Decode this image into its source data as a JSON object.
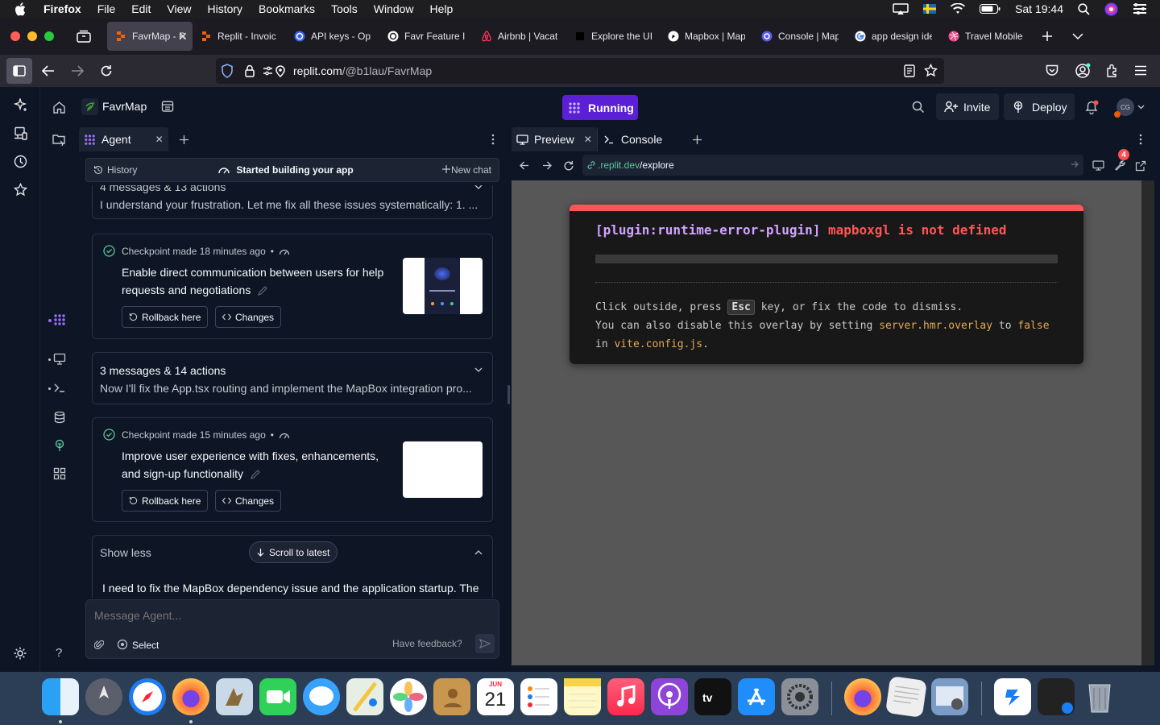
{
  "menubar": {
    "app": "Firefox",
    "items": [
      "File",
      "Edit",
      "View",
      "History",
      "Bookmarks",
      "Tools",
      "Window",
      "Help"
    ],
    "clock": "Sat 19:44"
  },
  "tabs": [
    {
      "label": "FavrMap - R",
      "active": true,
      "icon": "replit-icon"
    },
    {
      "label": "Replit - Invoic",
      "icon": "replit-icon"
    },
    {
      "label": "API keys - Op",
      "icon": "openai-icon"
    },
    {
      "label": "Favr Feature Ir",
      "icon": "chatgpt-icon"
    },
    {
      "label": "Airbnb | Vacat",
      "icon": "airbnb-icon"
    },
    {
      "label": "Explore the UI",
      "icon": "dribbble-icon"
    },
    {
      "label": "Mapbox | Map",
      "icon": "mapbox-icon"
    },
    {
      "label": "Console | Map",
      "icon": "console-icon"
    },
    {
      "label": "app design ide",
      "icon": "google-icon"
    },
    {
      "label": "Travel Mobile",
      "icon": "dribbble-icon"
    }
  ],
  "url": {
    "host": "replit.com",
    "path": "/@b1lau/FavrMap"
  },
  "replit": {
    "project": "FavrMap",
    "status": "Running",
    "invite": "Invite",
    "deploy": "Deploy",
    "avatar": "CG"
  },
  "agent": {
    "tab": "Agent",
    "history": "History",
    "status": "Started building your app",
    "new_chat": "New chat",
    "group1": {
      "summary": "4 messages & 13 actions",
      "preview": "I understand your frustration. Let me fix all these issues systematically: 1. ..."
    },
    "checkpoint1": {
      "title": "Checkpoint made 18 minutes ago",
      "message": "Enable direct communication between users for help requests and negotiations"
    },
    "group2": {
      "summary": "3 messages & 14 actions",
      "preview": "Now I'll fix the App.tsx routing and implement the MapBox integration pro..."
    },
    "checkpoint2": {
      "title": "Checkpoint made 15 minutes ago",
      "message": "Improve user experience with fixes, enhancements, and sign-up functionality"
    },
    "rollback": "Rollback here",
    "changes": "Changes",
    "show_less": "Show less",
    "scroll_latest": "Scroll to latest",
    "latest_text": "I need to fix the MapBox dependency issue and the application startup. The",
    "input_placeholder": "Message Agent...",
    "select": "Select",
    "feedback": "Have feedback?"
  },
  "preview": {
    "tab_preview": "Preview",
    "tab_console": "Console",
    "url_host": ".replit.dev",
    "url_path": "/explore",
    "badge": "4",
    "error": {
      "plugin": "[plugin:runtime-error-plugin]",
      "message": "mapboxgl is not defined",
      "hint1a": "Click outside, press",
      "hint1key": "Esc",
      "hint1b": "key, or fix the code to dismiss.",
      "hint2a": "You can also disable this overlay by setting",
      "hint2code": "server.hmr.overlay",
      "hint2b": "to",
      "hint2val": "false",
      "hint3a": "in",
      "hint3code": "vite.config.js",
      "hint3b": "."
    }
  },
  "dock": {
    "calendar_month": "JUN",
    "calendar_day": "21"
  },
  "colors": {
    "accent": "#5b1fd6",
    "error_red": "#ff5555",
    "code_yellow": "#e2aa53",
    "plugin_purple": "#cfa4ff"
  }
}
